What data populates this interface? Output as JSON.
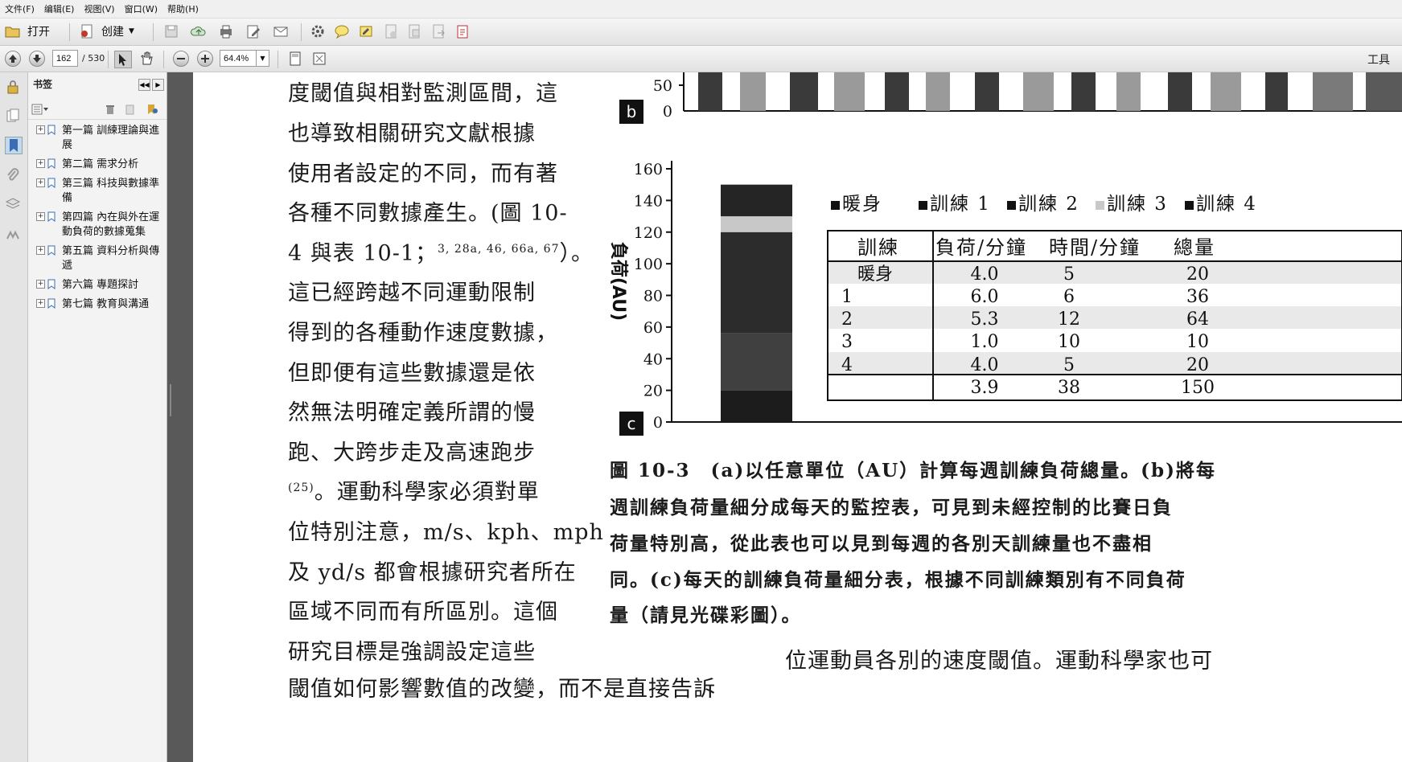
{
  "menu": [
    "文件(F)",
    "编辑(E)",
    "视图(V)",
    "窗口(W)",
    "帮助(H)"
  ],
  "toolbar": {
    "open_label": "打开",
    "create_label": "创建",
    "tools_label": "工具"
  },
  "nav": {
    "page_value": "162",
    "page_total": "/ 530",
    "zoom_value": "64.4%"
  },
  "bookmarks": {
    "title": "书签",
    "items": [
      {
        "label": "第一篇 訓練理論與進展"
      },
      {
        "label": "第二篇 需求分析"
      },
      {
        "label": "第三篇 科技與數據準備"
      },
      {
        "label": "第四篇 內在與外在運動負荷的數據蒐集"
      },
      {
        "label": "第五篇 資料分析與傳遞"
      },
      {
        "label": "第六篇 專題探討"
      },
      {
        "label": "第七篇 教育與溝通"
      }
    ]
  },
  "doc": {
    "left_lines": [
      "度閾值與相對監測區間，這",
      "也導致相關研究文獻根據",
      "使用者設定的不同，而有著",
      "各種不同數據產生。(圖 10-",
      "4 與表 10-1；",
      "這已經跨越不同運動限制",
      "得到的各種動作速度數據，",
      "但即便有這些數據還是依",
      "然無法明確定義所謂的慢",
      "跑、大跨步走及高速跑步",
      "。運動科學家必須對單",
      "位特別注意，m/s、kph、mph",
      "及 yd/s 都會根據研究者所在",
      "區域不同而有所區別。這個",
      "研究目標是強調設定這些",
      "閾值如何影響數值的改變，而不是直接告訴"
    ],
    "refs_line5": "3, 28a, 46, 66a, 67",
    "line5_tail": "）。",
    "ref_line11": "(25)",
    "caption_lines": [
      "圖 10-3　(a)以任意單位（AU）計算每週訓練負荷總量。(b)將每",
      "週訓練負荷量細分成每天的監控表，可見到未經控制的比賽日負",
      "荷量特別高，從此表也可以見到每週的各別天訓練量也不盡相",
      "同。(c)每天的訓練負荷量細分表，根據不同訓練類別有不同負荷",
      "量（請見光碟彩圖）。"
    ],
    "right_bottom_line": "位運動員各別的速度閾值。運動科學家也可"
  },
  "chart_b": {
    "label": "b",
    "y_ticks": [
      "50",
      "0"
    ]
  },
  "chart_data": {
    "type": "bar",
    "panel_label": "c",
    "ylabel": "負荷(AU)",
    "ylim": [
      0,
      160
    ],
    "y_ticks": [
      "0",
      "20",
      "40",
      "60",
      "80",
      "100",
      "120",
      "140",
      "160"
    ],
    "series": [
      {
        "name": "暖身",
        "values": [
          20
        ]
      },
      {
        "name": "訓練 1",
        "values": [
          36
        ]
      },
      {
        "name": "訓練 2",
        "values": [
          64
        ]
      },
      {
        "name": "訓練 3",
        "values": [
          10
        ]
      },
      {
        "name": "訓練 4",
        "values": [
          20
        ]
      }
    ],
    "legend": [
      "暖身",
      "訓練 1",
      "訓練 2",
      "訓練 3",
      "訓練 4"
    ],
    "colors": [
      "#1c1c1c",
      "#404040",
      "#2c2c2c",
      "#c8c8c8",
      "#252525"
    ],
    "table": {
      "headers": [
        "訓練",
        "負荷/分鐘",
        "時間/分鐘",
        "總量"
      ],
      "rows": [
        [
          "暖身",
          "4.0",
          "5",
          "20"
        ],
        [
          "1",
          "6.0",
          "6",
          "36"
        ],
        [
          "2",
          "5.3",
          "12",
          "64"
        ],
        [
          "3",
          "1.0",
          "10",
          "10"
        ],
        [
          "4",
          "4.0",
          "5",
          "20"
        ],
        [
          "",
          "3.9",
          "38",
          "150"
        ]
      ]
    }
  }
}
